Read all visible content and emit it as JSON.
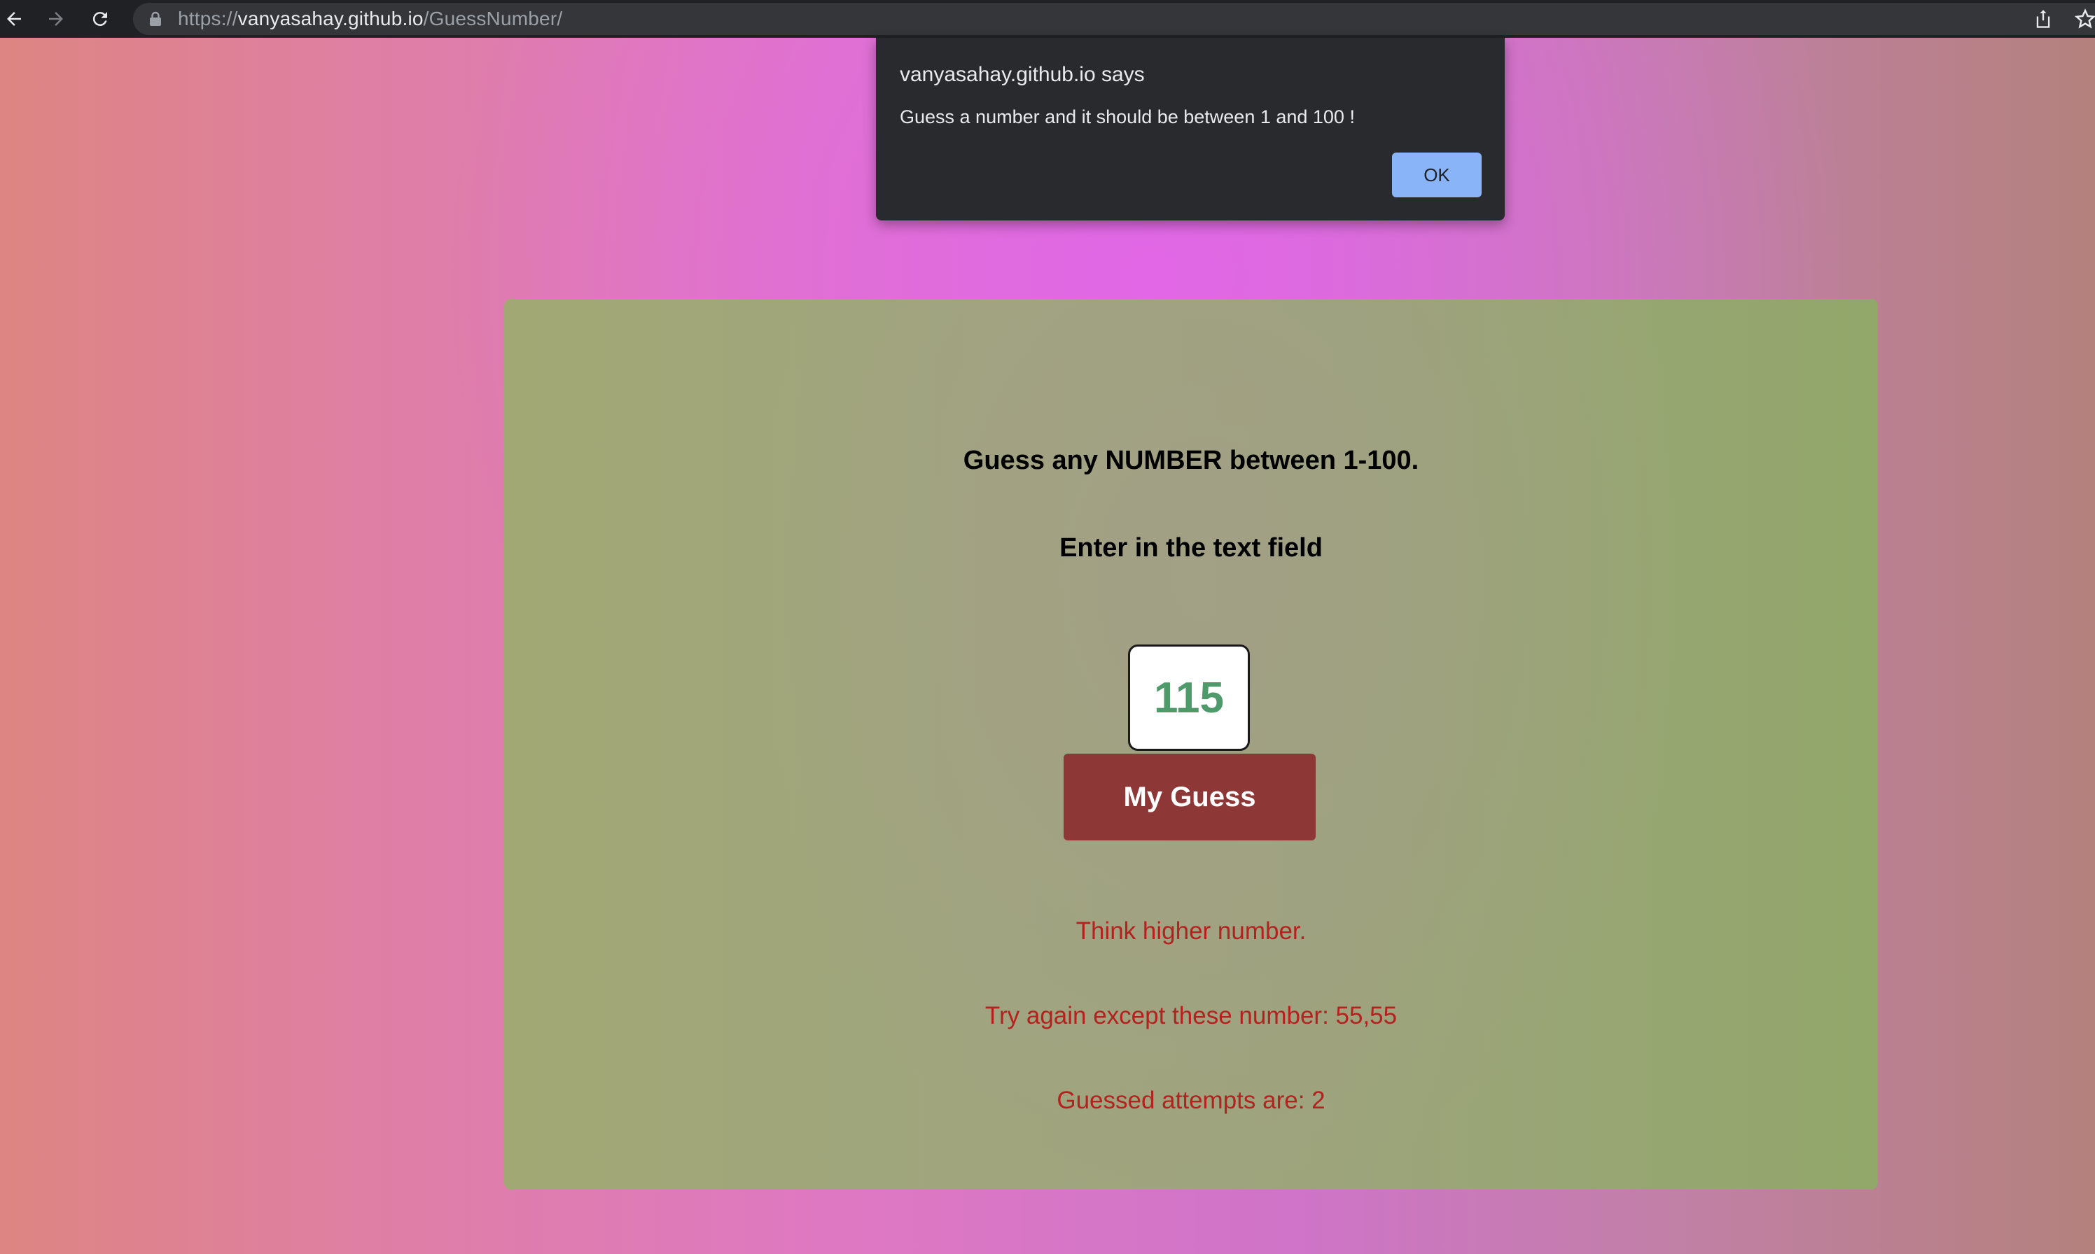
{
  "browser": {
    "url_scheme": "https://",
    "url_host": "vanyasahay.github.io",
    "url_path": "/GuessNumber/"
  },
  "dialog": {
    "title": "vanyasahay.github.io says",
    "message": "Guess a number and it should be between 1 and 100 !",
    "ok_label": "OK"
  },
  "game": {
    "heading": "Guess any NUMBER between 1-100.",
    "subheading": "Enter in the text field",
    "input_value": "115",
    "button_label": "My Guess",
    "hint_message": "Think higher number.",
    "previous_guesses_message": "Try again except these number: 55,55",
    "attempts_message": "Guessed attempts are: 2"
  },
  "colors": {
    "topbar": "#202124",
    "button": "#8d3737",
    "message_text": "#b3221f",
    "input_text": "#4e9a6a",
    "ok_button": "#8ab4f8"
  },
  "icons": {
    "back": "back-arrow-icon",
    "forward": "forward-arrow-icon",
    "reload": "reload-icon",
    "lock": "lock-icon",
    "share": "share-icon",
    "bookmark": "star-icon"
  }
}
